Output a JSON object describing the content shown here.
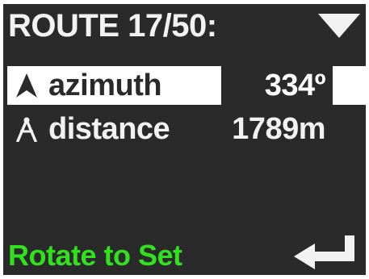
{
  "header": {
    "title": "ROUTE 17/50:",
    "menu_icon": "triangle-down-icon"
  },
  "rows": [
    {
      "icon": "arrow-up-icon",
      "label": "azimuth",
      "value": "334º",
      "selected": true
    },
    {
      "icon": "compass-divider-icon",
      "label": "distance",
      "value": "1789m",
      "selected": false
    }
  ],
  "footer": {
    "hint": "Rotate to Set",
    "enter_icon": "enter-return-icon"
  },
  "colors": {
    "background": "#2a2a2a",
    "text": "#f2f2f2",
    "highlight": "#ffffff",
    "hint": "#33e020"
  }
}
